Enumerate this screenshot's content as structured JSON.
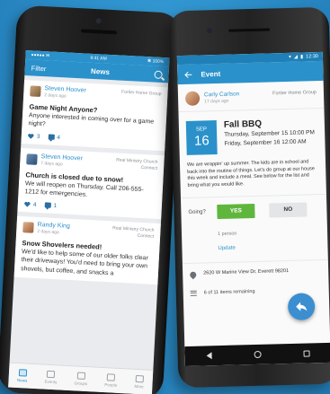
{
  "ios": {
    "status": {
      "carrier": "●●●●● ✉",
      "time": "9:41 AM",
      "battery": "✱ 100%"
    },
    "nav": {
      "filter": "Filter",
      "title": "News"
    },
    "posts": [
      {
        "author": "Steven Hoover",
        "time": "2 days ago",
        "group": "Fortier Home Group",
        "title": "Game Night Anyone?",
        "body": "Anyone interested in coming over for a game night?",
        "likes": "3",
        "comments": "4"
      },
      {
        "author": "Steven Hoover",
        "time": "7 days ago",
        "group": "Real Ministry Church Connect",
        "title": "Church is closed due to snow!",
        "body": "We will reopen on Thursday. Call 206-555-1212 for emergencies.",
        "likes": "4",
        "comments": "1"
      },
      {
        "author": "Randy King",
        "time": "2 days ago",
        "group": "Real Ministry Church Connect",
        "title": "Snow Shovelers needed!",
        "body": "We'd like to help some of our older folks clear their driveways! You'd need to bring your own shovels, but coffee, and snacks a"
      }
    ],
    "tabs": [
      {
        "label": "News"
      },
      {
        "label": "Events"
      },
      {
        "label": "Groups"
      },
      {
        "label": "People"
      },
      {
        "label": "More"
      }
    ]
  },
  "android": {
    "status": {
      "time": "12:30"
    },
    "toolbar": {
      "title": "Event"
    },
    "event": {
      "author": "Carly Carlson",
      "time": "17 days ago",
      "group": "Fortier Home Group",
      "month": "SEP",
      "day": "16",
      "title": "Fall BBQ",
      "start": "Thursday, September 15 10:00 PM",
      "end": "Friday, September 16  12:00 AM",
      "description": "We are wrappin' up summer. The kids are in school and back into the routine of things. Let's do group at our house this week and include a meal. See below for the list and bring what you would like.",
      "going_label": "Going?",
      "yes_label": "YES",
      "no_label": "NO",
      "attending": "1 person",
      "update_label": "Update",
      "address": "2620 W Marine View Dr, Everett 98201",
      "items": "6 of 11 items remaining"
    }
  },
  "colors": {
    "brand_blue": "#2a91cb",
    "yes_green": "#5fb63c",
    "background": "#2f93cf"
  }
}
